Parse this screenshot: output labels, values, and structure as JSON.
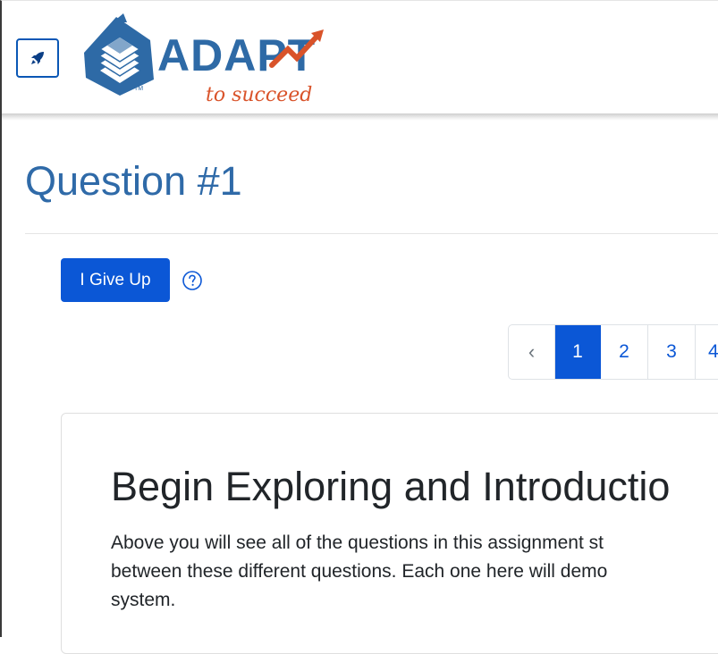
{
  "header": {
    "menu_icon": "rocket-icon",
    "logo": {
      "name": "ADAPT",
      "tagline": "to succeed",
      "trademark": "TM",
      "icon": "stacked-books-icon"
    }
  },
  "question": {
    "title": "Question #1",
    "give_up_label": "I Give Up",
    "help_icon": "question-circle-icon"
  },
  "pagination": {
    "prev_label": "‹",
    "pages": [
      "1",
      "2",
      "3",
      "4"
    ],
    "active_page": "1"
  },
  "content": {
    "heading": "Begin Exploring and Introductio",
    "lines": [
      "Above you will see all of the questions in this assignment st",
      "between these different questions. Each one here will demo",
      "system."
    ]
  },
  "colors": {
    "primary": "#0b57d6",
    "title_blue": "#2f6aa8",
    "logo_blue": "#2e6aa6",
    "tagline_orange": "#d9532a"
  }
}
